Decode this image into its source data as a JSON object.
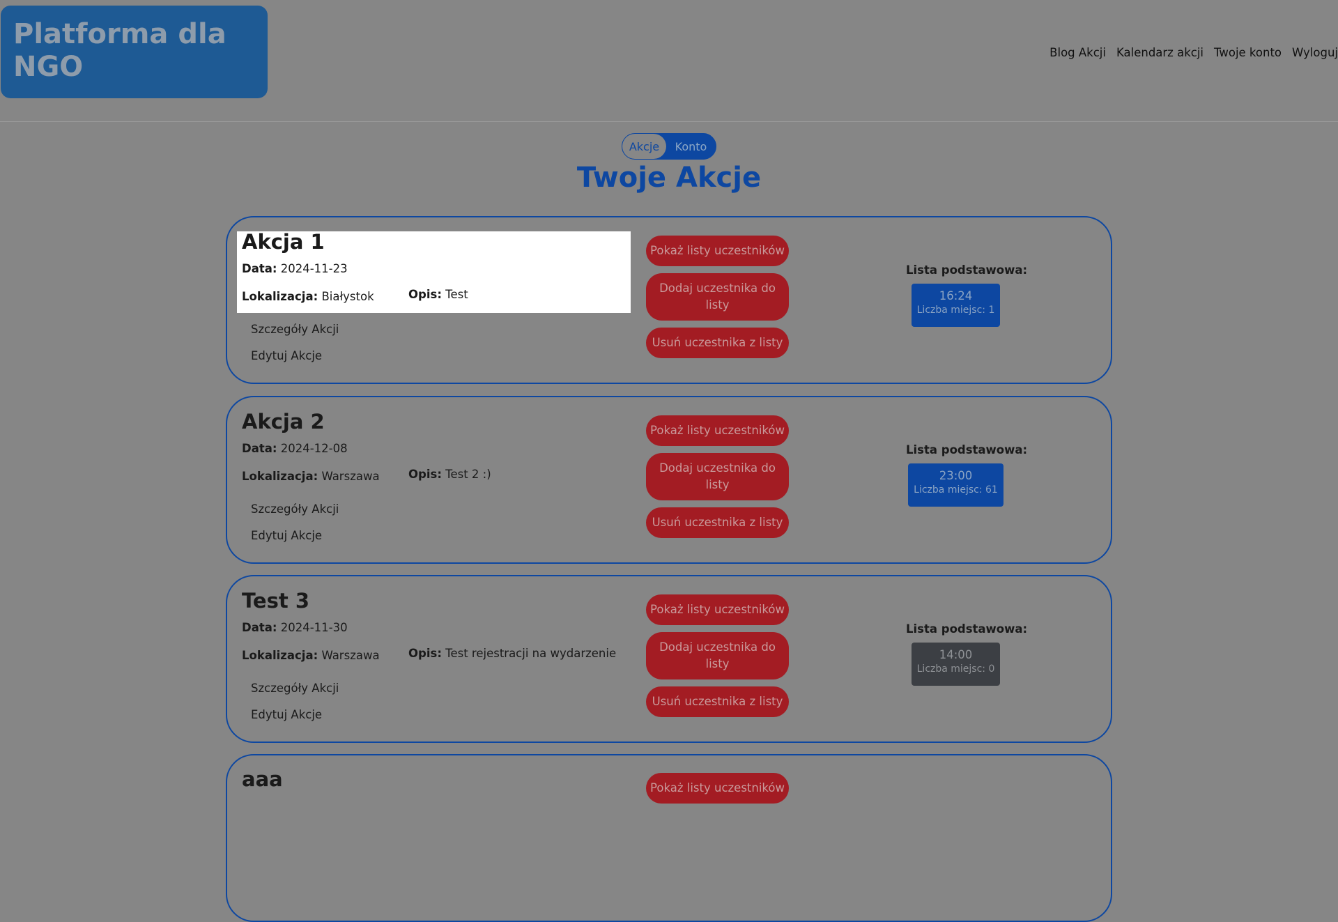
{
  "brand": {
    "title": "Platforma dla NGO"
  },
  "nav": {
    "items": [
      "Blog Akcji",
      "Kalendarz akcji",
      "Twoje konto",
      "Wyloguj"
    ]
  },
  "toggle": {
    "active": "Akcje",
    "inactive": "Konto"
  },
  "page_title": "Twoje Akcje",
  "labels": {
    "date": "Data:",
    "location": "Lokalizacja:",
    "description": "Opis:",
    "details_link": "Szczegóły Akcji",
    "edit_link": "Edytuj Akcje",
    "show_lists_button": "Pokaż listy uczestników",
    "add_participant_button": "Dodaj uczestnika do listy",
    "remove_participant_button": "Usuń uczestnika z listy",
    "basic_list": "Lista podstawowa:",
    "seats_prefix": "Liczba miejsc:"
  },
  "events": [
    {
      "title": "Akcja 1",
      "date": "2024-11-23",
      "location": "Białystok",
      "description": "Test",
      "slot_time": "16:24",
      "slot_count": "Liczba miejsc: 1",
      "slot_status": "available"
    },
    {
      "title": "Akcja 2",
      "date": "2024-12-08",
      "location": "Warszawa",
      "description": "Test 2 :)",
      "slot_time": "23:00",
      "slot_count": "Liczba miejsc: 61",
      "slot_status": "available"
    },
    {
      "title": "Test 3",
      "date": "2024-11-30",
      "location": "Warszawa",
      "description": "Test rejestracji na wydarzenie",
      "slot_time": "14:00",
      "slot_count": "Liczba miejsc: 0",
      "slot_status": "full"
    },
    {
      "title": "aaa",
      "date": "",
      "location": "",
      "description": "",
      "slot_time": "",
      "slot_count": "",
      "slot_status": ""
    }
  ],
  "colors": {
    "background": "#868686",
    "brand_blue": "#1e5a94",
    "primary_blue": "#0d47a1",
    "danger_red": "#a31c23",
    "highlight": "#ffffff",
    "slot_full": "#3c3f44"
  }
}
